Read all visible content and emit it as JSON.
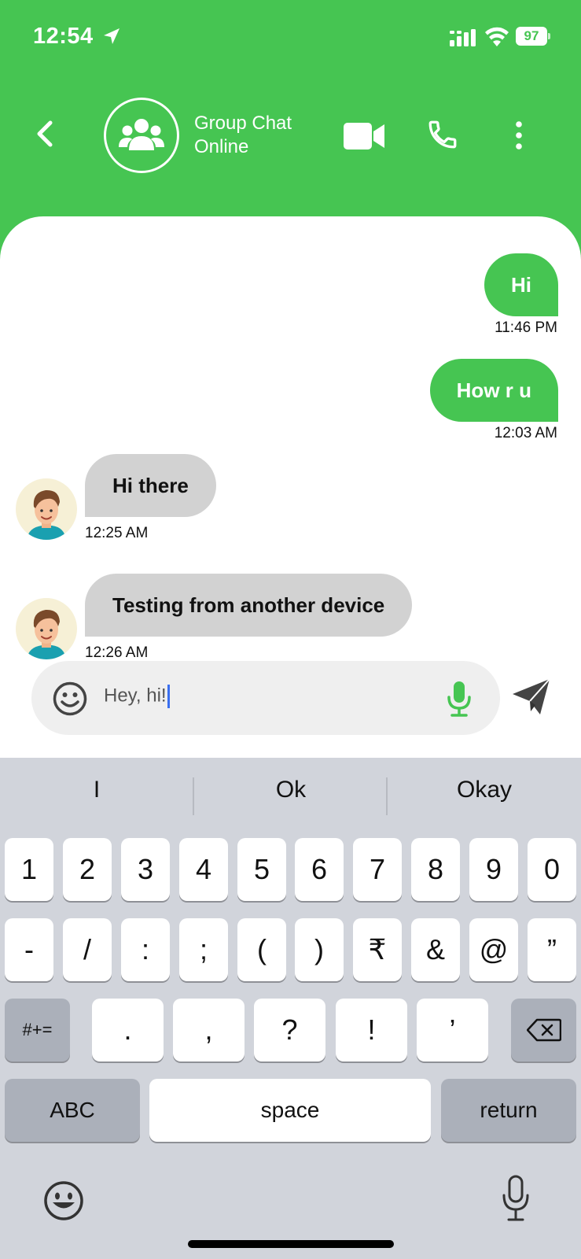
{
  "status_bar": {
    "time": "12:54",
    "battery": "97",
    "location_icon": "location-arrow-icon",
    "signal_icon": "cellular-signal-icon",
    "wifi_icon": "wifi-icon"
  },
  "header": {
    "back_icon": "chevron-left-icon",
    "avatar_icon": "group-icon",
    "title": "Group Chat",
    "status": "Online",
    "video_icon": "video-camera-icon",
    "call_icon": "phone-icon",
    "more_icon": "more-vertical-icon",
    "color": "#46c552"
  },
  "messages": [
    {
      "direction": "outgoing",
      "text": "Hi",
      "time": "11:46 PM"
    },
    {
      "direction": "outgoing",
      "text": "How r u",
      "time": "12:03 AM"
    },
    {
      "direction": "incoming",
      "text": "Hi there",
      "time": "12:25 AM"
    },
    {
      "direction": "incoming",
      "text": "Testing from another device",
      "time": "12:26 AM"
    }
  ],
  "composer": {
    "value": "Hey, hi!",
    "emoji_icon": "smiley-icon",
    "mic_icon": "microphone-icon",
    "send_icon": "send-icon"
  },
  "keyboard": {
    "suggestions": [
      "I",
      "Ok",
      "Okay"
    ],
    "row1": [
      "1",
      "2",
      "3",
      "4",
      "5",
      "6",
      "7",
      "8",
      "9",
      "0"
    ],
    "row2": [
      "-",
      "/",
      ":",
      ";",
      "(",
      ")",
      "₹",
      "&",
      "@",
      "”"
    ],
    "row3": [
      "#+=",
      ".",
      ",",
      "?",
      "!",
      "’"
    ],
    "backspace_icon": "backspace-icon",
    "abc": "ABC",
    "space": "space",
    "return": "return",
    "emoji_icon": "emoji-keyboard-icon",
    "dictation_icon": "dictation-mic-icon"
  }
}
